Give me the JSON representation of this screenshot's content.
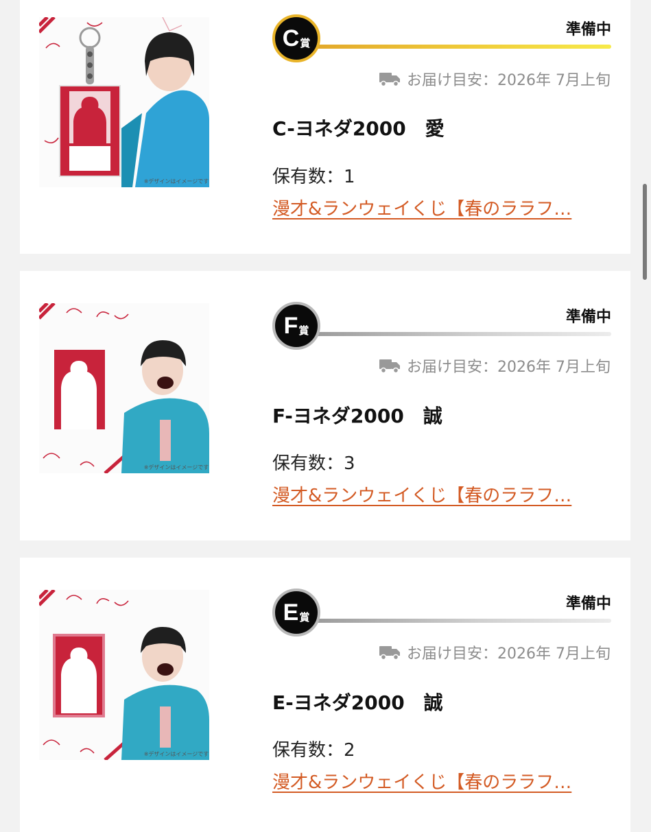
{
  "items": [
    {
      "rank_letter": "C",
      "rank_suffix": "賞",
      "status": "準備中",
      "delivery": "お届け目安：2026年 7月上旬",
      "name": "C-ヨネダ2000　愛",
      "owned": "保有数：1",
      "lottery_link": "漫才&ランウェイくじ【春のララフ…"
    },
    {
      "rank_letter": "F",
      "rank_suffix": "賞",
      "status": "準備中",
      "delivery": "お届け目安：2026年 7月上旬",
      "name": "F-ヨネダ2000　誠",
      "owned": "保有数：3",
      "lottery_link": "漫才&ランウェイくじ【春のララフ…"
    },
    {
      "rank_letter": "E",
      "rank_suffix": "賞",
      "status": "準備中",
      "delivery": "お届け目安：2026年 7月上旬",
      "name": "E-ヨネダ2000　誠",
      "owned": "保有数：2",
      "lottery_link": "漫才&ランウェイくじ【春のララフ…"
    }
  ],
  "colors": {
    "link": "#d35a23",
    "gold": "#e9b429",
    "silver": "#b9b9b9",
    "accent_red": "#c8233b"
  },
  "icons": {
    "delivery": "truck-icon"
  }
}
